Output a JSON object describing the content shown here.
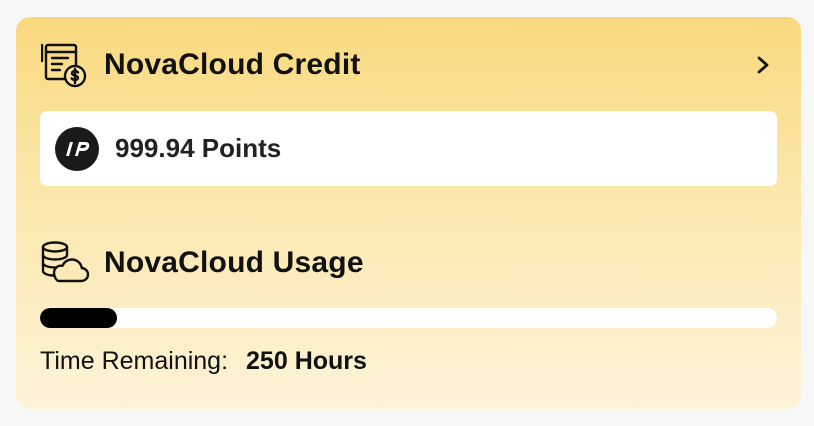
{
  "credit": {
    "title": "NovaCloud Credit",
    "icon": "invoice-dollar-icon",
    "chevron_icon": "chevron-right-icon",
    "points_logo": "np-logo-icon",
    "points_text": "999.94 Points"
  },
  "usage": {
    "title": "NovaCloud Usage",
    "icon": "database-cloud-icon",
    "progress_fraction": 0.105,
    "time_label": "Time Remaining:",
    "time_value": "250 Hours"
  },
  "colors": {
    "gradient_top": "#f9d97e",
    "gradient_bottom": "#fdf3d8",
    "progress_fill": "#000000",
    "progress_track": "#ffffff"
  }
}
